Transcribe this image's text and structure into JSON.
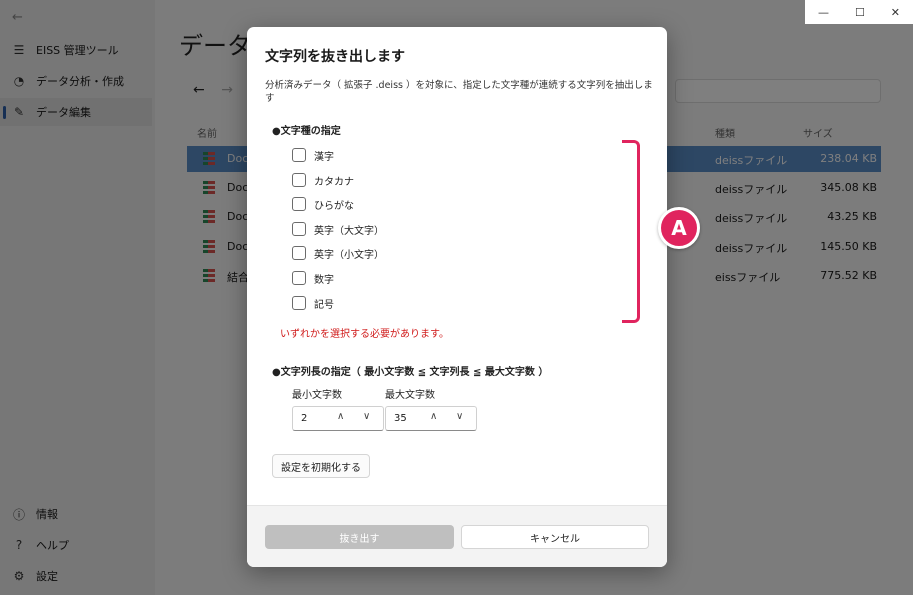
{
  "sidebar": {
    "back_glyph": "←",
    "app_title": "EISS 管理ツール",
    "items": [
      {
        "label": "データ分析・作成",
        "icon": "chart-icon",
        "glyph": "◔"
      },
      {
        "label": "データ編集",
        "icon": "edit-icon",
        "glyph": "✎"
      }
    ],
    "bottom_items": [
      {
        "label": "情報",
        "icon": "info-icon",
        "glyph": "ⓘ"
      },
      {
        "label": "ヘルプ",
        "icon": "help-icon",
        "glyph": "?"
      },
      {
        "label": "設定",
        "icon": "gear-icon",
        "glyph": "⚙"
      }
    ],
    "menu_glyph": "☰"
  },
  "window_controls": {
    "minimize": "—",
    "maximize": "☐",
    "close": "✕"
  },
  "main": {
    "title": "データ編",
    "nav": {
      "back": "←",
      "forward": "→"
    },
    "columns": {
      "name": "名前",
      "type": "種類",
      "size": "サイズ"
    },
    "files": [
      {
        "name": "Doc",
        "type": "deissファイル",
        "size": "238.04 KB",
        "selected": true
      },
      {
        "name": "Doc",
        "type": "deissファイル",
        "size": "345.08 KB"
      },
      {
        "name": "Doc",
        "type": "deissファイル",
        "size": "43.25 KB"
      },
      {
        "name": "Doc",
        "type": "deissファイル",
        "size": "145.50 KB"
      },
      {
        "name": "結合",
        "type": "eissファイル",
        "size": "775.52 KB"
      }
    ]
  },
  "dialog": {
    "title": "文字列を抜き出します",
    "description": "分析済みデータ（ 拡張子 .deiss ）を対象に、指定した文字種が連続する文字列を抽出します",
    "char_type_heading": "●文字種の指定",
    "char_types": [
      "漢字",
      "カタカナ",
      "ひらがな",
      "英字（大文字）",
      "英字（小文字）",
      "数字",
      "記号"
    ],
    "error": "いずれかを選択する必要があります。",
    "length_heading": "●文字列長の指定（ 最小文字数 ≦ 文字列長 ≦ 最大文字数 ）",
    "min_label": "最小文字数",
    "min_value": "2",
    "max_label": "最大文字数",
    "max_value": "35",
    "spin_up": "∧",
    "spin_down": "∨",
    "reset_label": "設定を初期化する",
    "extract_label": "抜き出す",
    "cancel_label": "キャンセル"
  },
  "annotation": {
    "callout_label": "A",
    "color": "#e0245e"
  }
}
